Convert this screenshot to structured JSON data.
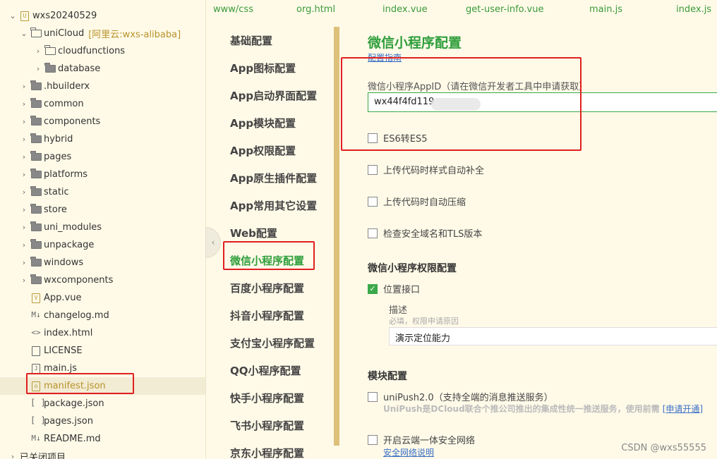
{
  "tree": {
    "root": "wxs20240529",
    "unicloud": "uniCloud",
    "unicloud_tag": "[阿里云:wxs-alibaba]",
    "items": [
      "cloudfunctions",
      "database",
      ".hbuilderx",
      "common",
      "components",
      "hybrid",
      "pages",
      "platforms",
      "static",
      "store",
      "uni_modules",
      "unpackage",
      "windows",
      "wxcomponents",
      "App.vue",
      "changelog.md",
      "index.html",
      "LICENSE",
      "main.js",
      "manifest.json",
      "package.json",
      "pages.json",
      "README.md",
      "已关闭项目"
    ]
  },
  "tabs": [
    "www/css",
    "org.html",
    "index.vue",
    "get-user-info.vue",
    "main.js",
    "index.js"
  ],
  "nav": [
    "基础配置",
    "App图标配置",
    "App启动界面配置",
    "App模块配置",
    "App权限配置",
    "App原生插件配置",
    "App常用其它设置",
    "Web配置",
    "微信小程序配置",
    "百度小程序配置",
    "抖音小程序配置",
    "支付宝小程序配置",
    "QQ小程序配置",
    "快手小程序配置",
    "飞书小程序配置",
    "京东小程序配置"
  ],
  "main": {
    "title": "微信小程序配置",
    "guide": "配置指南",
    "appid_label": "微信小程序AppID（请在微信开发者工具中申请获取）",
    "appid_value": "wx44f4fd119",
    "es6": "ES6转ES5",
    "autoprefix": "上传代码时样式自动补全",
    "minify": "上传代码时自动压缩",
    "check_domain": "检查安全域名和TLS版本",
    "perm_section": "微信小程序权限配置",
    "location": "位置接口",
    "desc_label": "描述",
    "desc_hint": "必填，权限申请原因",
    "desc_value": "演示定位能力",
    "module_section": "模块配置",
    "unipush": "uniPush2.0（支持全端的消息推送服务）",
    "unipush_note": "UniPush是DCloud联合个推公司推出的集成性统一推送服务，使用前需",
    "unipush_link": "[申请开通]",
    "secure_net": "开启云端一体安全网络",
    "secure_link": "安全网络说明"
  },
  "watermark": "CSDN @wxs55555"
}
